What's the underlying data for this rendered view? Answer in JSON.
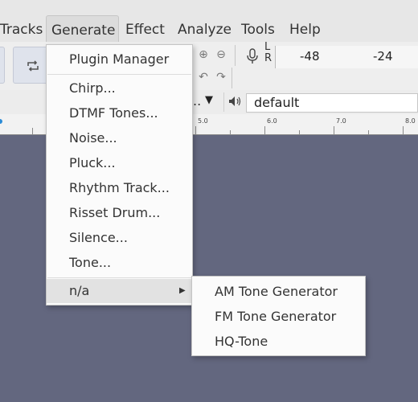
{
  "menubar": {
    "items": [
      "Tracks",
      "Generate",
      "Effect",
      "Analyze",
      "Tools",
      "Help"
    ]
  },
  "meter": {
    "lr_top": "L",
    "lr_bottom": "R",
    "scale": [
      "-48",
      "-24"
    ]
  },
  "device": {
    "partial": "..",
    "output": "default"
  },
  "ruler": {
    "labels": [
      "5.0",
      "6.0",
      "7.0",
      "8.0"
    ]
  },
  "generate_menu": {
    "items": [
      "Plugin Manager",
      "Chirp...",
      "DTMF Tones...",
      "Noise...",
      "Pluck...",
      "Rhythm Track...",
      "Risset Drum...",
      "Silence...",
      "Tone...",
      "n/a"
    ]
  },
  "submenu": {
    "items": [
      "AM Tone Generator",
      "FM Tone Generator",
      "HQ-Tone"
    ]
  },
  "colors": {
    "track_area": "#63677f",
    "menu_bg": "#fbfbfb",
    "highlight": "#e2e2e2"
  }
}
